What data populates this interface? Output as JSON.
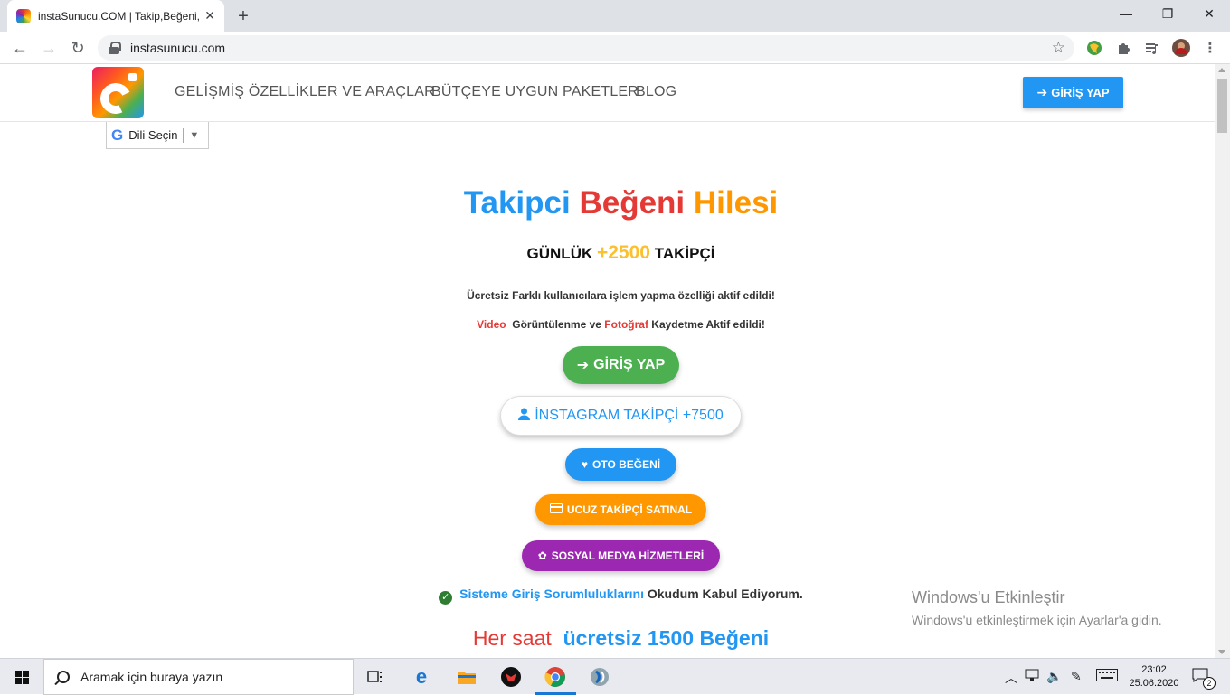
{
  "browser": {
    "tab_title": "instaSunucu.COM | Takip,Beğeni,H",
    "tab_close": "✕",
    "new_tab": "+",
    "url": "instasunucu.com",
    "win_minimize": "—",
    "win_restore": "❐",
    "win_close": "✕",
    "back": "←",
    "forward": "→",
    "reload": "↻",
    "star": "☆"
  },
  "site": {
    "nav": {
      "features": "GELİŞMİŞ ÖZELLİKLER VE ARAÇLAR",
      "packages": "BÜTÇEYE UYGUN PAKETLER",
      "blog": "BLOG"
    },
    "header_login": "GİRİŞ YAP",
    "language_select": "Dili Seçin",
    "hero": {
      "word1": "Takipci",
      "word2": "Beğeni",
      "word3": "Hilesi"
    },
    "daily": {
      "prefix": "GÜNLÜK",
      "number": "+2500",
      "suffix": "TAKİPÇİ"
    },
    "note1": "Ücretsiz Farklı kullanıcılara işlem yapma özelliği aktif edildi!",
    "note2": {
      "video": "Video",
      "middle": "Görüntülenme ve",
      "photo": "Fotoğraf",
      "end": "Kaydetme Aktif edildi!"
    },
    "buttons": {
      "login": "GİRİŞ YAP",
      "instagram": "İNSTAGRAM TAKİPÇİ +7500",
      "oto": "OTO BEĞENİ",
      "ucuz": "UCUZ TAKİPÇİ SATINAL",
      "sosyal": "SOSYAL MEDYA HİZMETLERİ"
    },
    "terms": {
      "link": "Sisteme Giriş Sorumluluklarını",
      "rest": "Okudum Kabul Ediyorum."
    },
    "hourly": {
      "part1": "Her saat",
      "part2": "ücretsiz 1500 Beğeni"
    }
  },
  "activation": {
    "title": "Windows'u Etkinleştir",
    "subtitle": "Windows'u etkinleştirmek için Ayarlar'a gidin."
  },
  "taskbar": {
    "search_placeholder": "Aramak için buraya yazın",
    "time": "23:02",
    "date": "25.06.2020",
    "notification_count": "2"
  },
  "colors": {
    "blue": "#2196f3",
    "red": "#e53935",
    "orange": "#ff9800",
    "green": "#4caf50",
    "purple": "#9c27b0",
    "yellow": "#fbc02d"
  }
}
